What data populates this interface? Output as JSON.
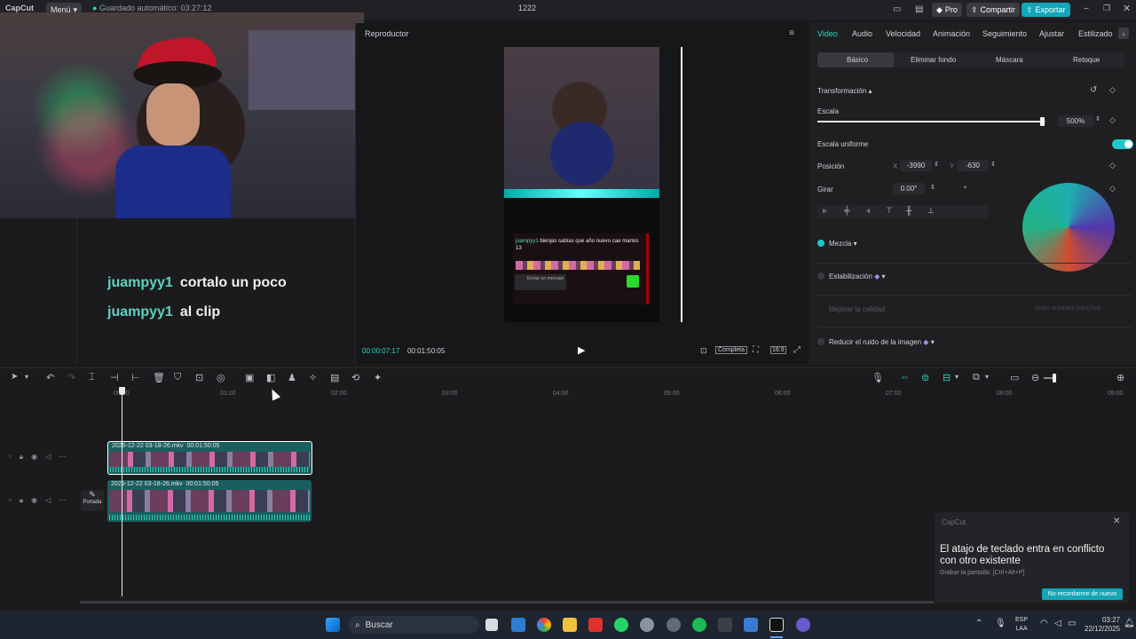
{
  "titlebar": {
    "app_name": "CapCut",
    "menu_label": "Menú",
    "autosave_text": "Guardado automático: 03:27:12",
    "project_name": "1222",
    "pro_label": "Pro",
    "share_label": "Compartir",
    "export_label": "Exportar"
  },
  "chat": [
    {
      "user": "juampyy1",
      "message": "cortalo un poco"
    },
    {
      "user": "juampyy1",
      "message": "al clip"
    }
  ],
  "player": {
    "title": "Reproductor",
    "current_time": "00:00:07:17",
    "total_time": "00:01:50:05",
    "ratio_label": "Completa",
    "aspect_label": "16:9",
    "video_overlay": {
      "chat_user": "juampyy1",
      "chat_text": "bienjas sabías que año nuevo cae martes 13",
      "send_label": "Enviar un mensaje"
    }
  },
  "rpanel": {
    "tabs": [
      "Video",
      "Audio",
      "Velocidad",
      "Animación",
      "Seguimiento",
      "Ajustar",
      "Estilizado"
    ],
    "active_tab": "Video",
    "subtabs": [
      "Básico",
      "Eliminar fondo",
      "Máscara",
      "Retoque"
    ],
    "active_subtab": "Básico",
    "transform_label": "Transformación",
    "scale_label": "Escala",
    "scale_value": "500%",
    "scale_fraction": 0.98,
    "uniform_scale_label": "Escala uniforme",
    "uniform_scale_on": true,
    "position_label": "Posición",
    "pos_x_label": "X",
    "pos_x": "-3990",
    "pos_y_label": "Y",
    "pos_y": "-630",
    "rotate_label": "Girar",
    "rotate_value": "0.00°",
    "blend_label": "Mezcla",
    "stabilize_label": "Estabilización",
    "improve_quality_label": "Mejorar la calidad",
    "improve_quality_note": "Usan recursos para hoy",
    "noise_label": "Reducir el ruido de la imagen"
  },
  "timeline": {
    "ticks": [
      "00:00",
      "01:00",
      "02:00",
      "03:00",
      "04:00",
      "05:00",
      "06:00",
      "07:00",
      "08:00",
      "09:00"
    ],
    "clips": [
      {
        "label": "2025-12-22 03-18-26.mkv",
        "duration": "00:01:50:05"
      },
      {
        "label": "2025-12-22 03-18-26.mkv",
        "duration": "00:01:50:05"
      }
    ],
    "cover_label": "Portada"
  },
  "toast": {
    "app": "CapCut",
    "title": "El atajo de teclado entra en conflicto con otro existente",
    "subtitle": "Grabar la pantalla: [Ctrl+Alt+P]",
    "button": "No recordarme de nuevo"
  },
  "taskbar": {
    "search_placeholder": "Buscar",
    "lang": "ESP",
    "lang_sub": "LAA",
    "time": "03:27",
    "date": "22/12/2025"
  },
  "colors": {
    "accent": "#1ec8c8",
    "export": "#12a6b8",
    "chat_user": "#5fd1c0"
  }
}
